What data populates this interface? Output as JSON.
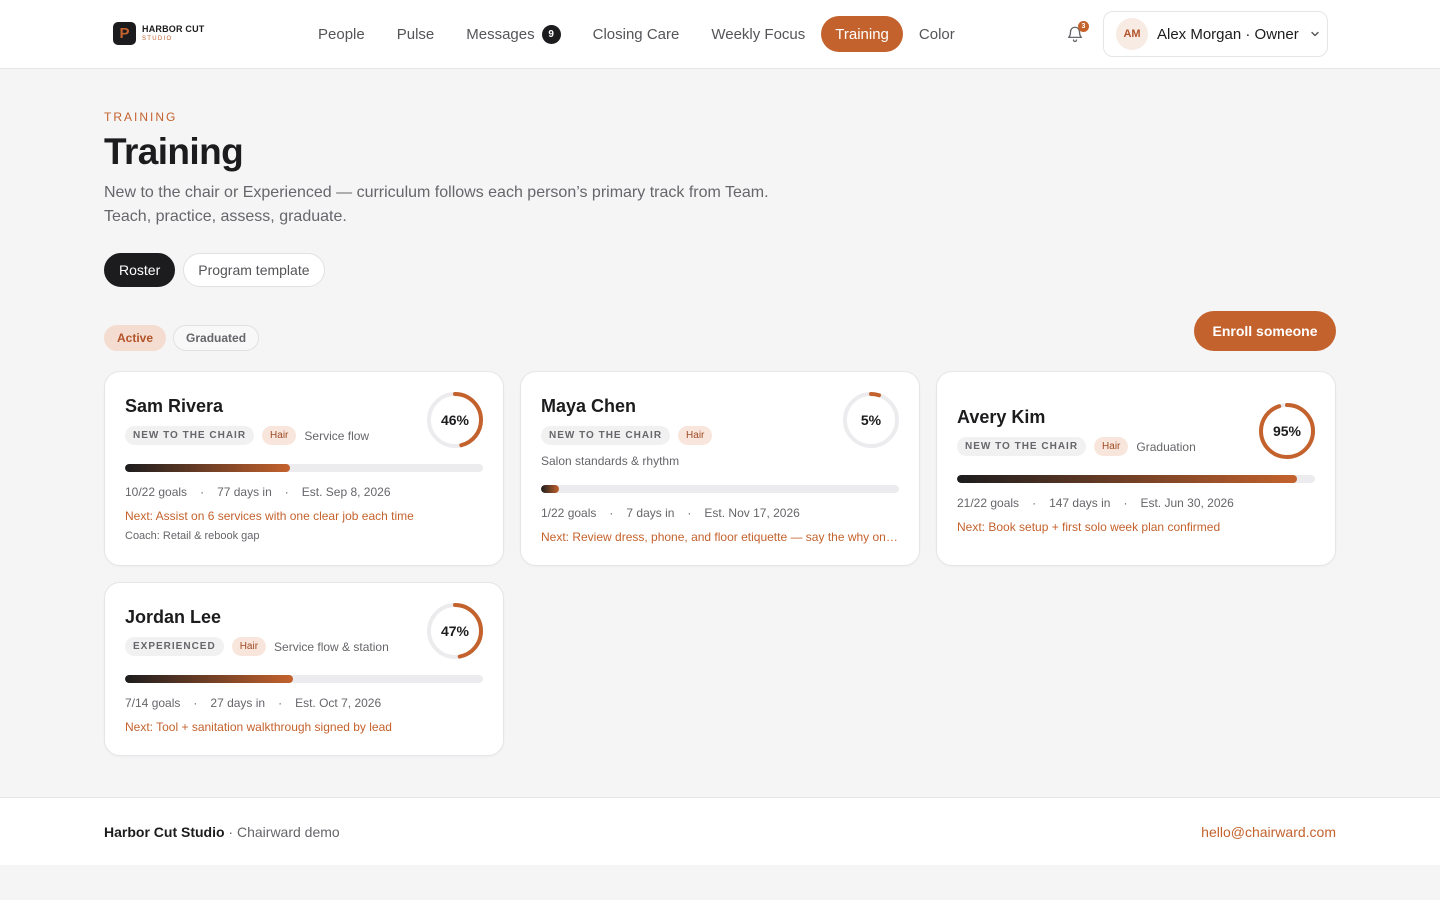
{
  "brand": {
    "mark": "P",
    "name": "HARBOR CUT",
    "sub": "STUDIO"
  },
  "nav": {
    "items": [
      {
        "label": "People"
      },
      {
        "label": "Pulse"
      },
      {
        "label": "Messages",
        "badge": "9"
      },
      {
        "label": "Closing Care"
      },
      {
        "label": "Weekly Focus"
      },
      {
        "label": "Training",
        "active": true
      },
      {
        "label": "Color"
      }
    ]
  },
  "notifications": {
    "icon": "bell-icon",
    "count": "3"
  },
  "user": {
    "initials": "AM",
    "name": "Alex Morgan · Owner",
    "icon": "chevron-down-icon"
  },
  "page": {
    "eyebrow": "TRAINING",
    "title": "Training",
    "description": "New to the chair or Experienced — curriculum follows each person’s primary track from Team. Teach, practice, assess, graduate."
  },
  "views": {
    "roster": "Roster",
    "template": "Program template",
    "selected": "Roster"
  },
  "filters": {
    "active": "Active",
    "graduated": "Graduated",
    "selected": "Active"
  },
  "enroll_label": "Enroll someone",
  "colors": {
    "accent": "#c4622d",
    "dark": "#1c1c1e",
    "ring_track": "#ececee"
  },
  "trainees": [
    {
      "name": "Sam Rivera",
      "track": "NEW TO THE CHAIR",
      "skill": "Hair",
      "stage": "Service flow",
      "progress": 46,
      "progress_label": "46%",
      "goals": "10/22 goals",
      "days": "77 days in",
      "est": "Est. Sep 8, 2026",
      "next": "Next: Assist on 6 services with one clear job each time",
      "coach": "Coach: Retail & rebook gap"
    },
    {
      "name": "Maya Chen",
      "track": "NEW TO THE CHAIR",
      "skill": "Hair",
      "stage": "Salon standards & rhythm",
      "progress": 5,
      "progress_label": "5%",
      "goals": "1/22 goals",
      "days": "7 days in",
      "est": "Est. Nov 17, 2026",
      "next": "Next: Review dress, phone, and floor etiquette — say the why on each one"
    },
    {
      "name": "Avery Kim",
      "track": "NEW TO THE CHAIR",
      "skill": "Hair",
      "stage": "Graduation",
      "progress": 95,
      "progress_label": "95%",
      "goals": "21/22 goals",
      "days": "147 days in",
      "est": "Est. Jun 30, 2026",
      "next": "Next: Book setup + first solo week plan confirmed"
    },
    {
      "name": "Jordan Lee",
      "track": "EXPERIENCED",
      "skill": "Hair",
      "stage": "Service flow & station",
      "progress": 47,
      "progress_label": "47%",
      "goals": "7/14 goals",
      "days": "27 days in",
      "est": "Est. Oct 7, 2026",
      "next": "Next: Tool + sanitation walkthrough signed by lead"
    }
  ],
  "footer": {
    "studio": "Harbor Cut Studio",
    "suffix": " · Chairward demo",
    "email": "hello@chairward.com"
  }
}
